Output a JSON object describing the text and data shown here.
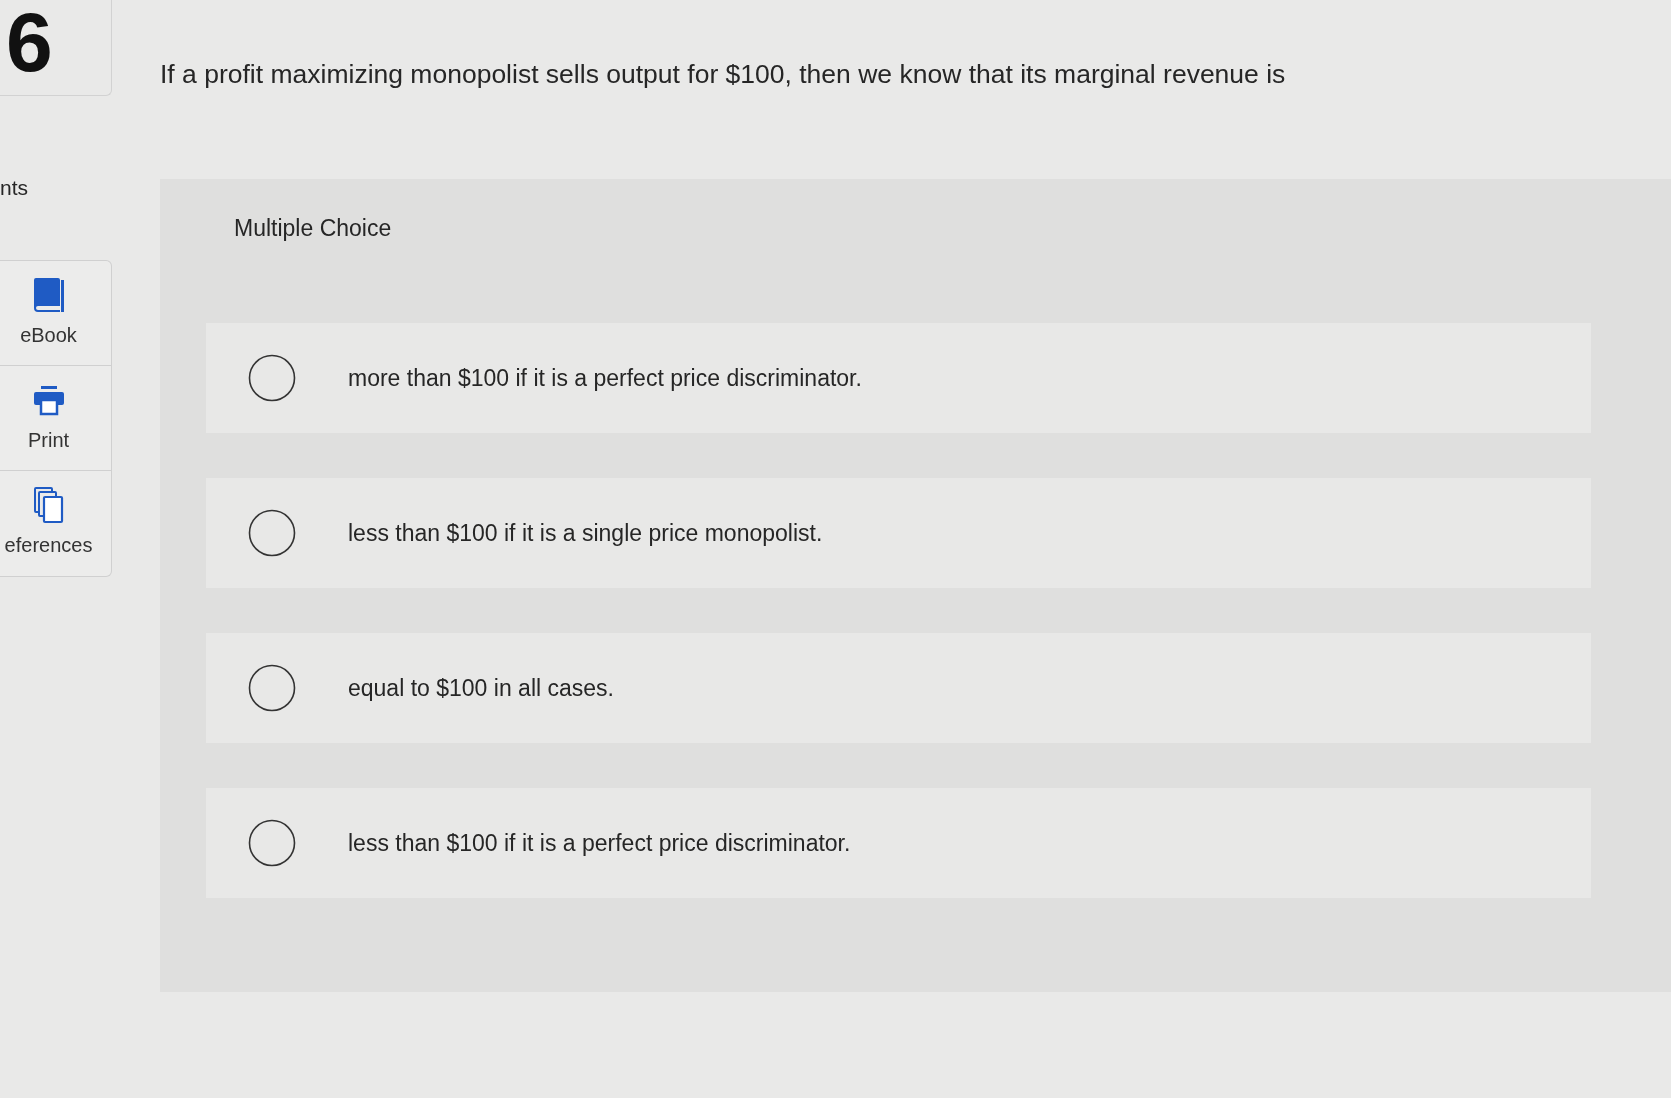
{
  "question_number": "6",
  "sidebar": {
    "label": "nts",
    "items": [
      {
        "kind": "ebook",
        "label": "eBook"
      },
      {
        "kind": "print",
        "label": "Print"
      },
      {
        "kind": "references",
        "label": "eferences"
      }
    ]
  },
  "question": {
    "text": "If a profit maximizing monopolist sells output for $100, then we know that its marginal revenue is"
  },
  "answer_panel": {
    "title": "Multiple Choice",
    "options": [
      {
        "label": "more than $100 if it is a perfect price discriminator.",
        "selected": false
      },
      {
        "label": "less than $100 if it is a single price monopolist.",
        "selected": false
      },
      {
        "label": "equal to $100 in all cases.",
        "selected": false
      },
      {
        "label": "less than $100 if it is a perfect price discriminator.",
        "selected": false
      }
    ]
  }
}
